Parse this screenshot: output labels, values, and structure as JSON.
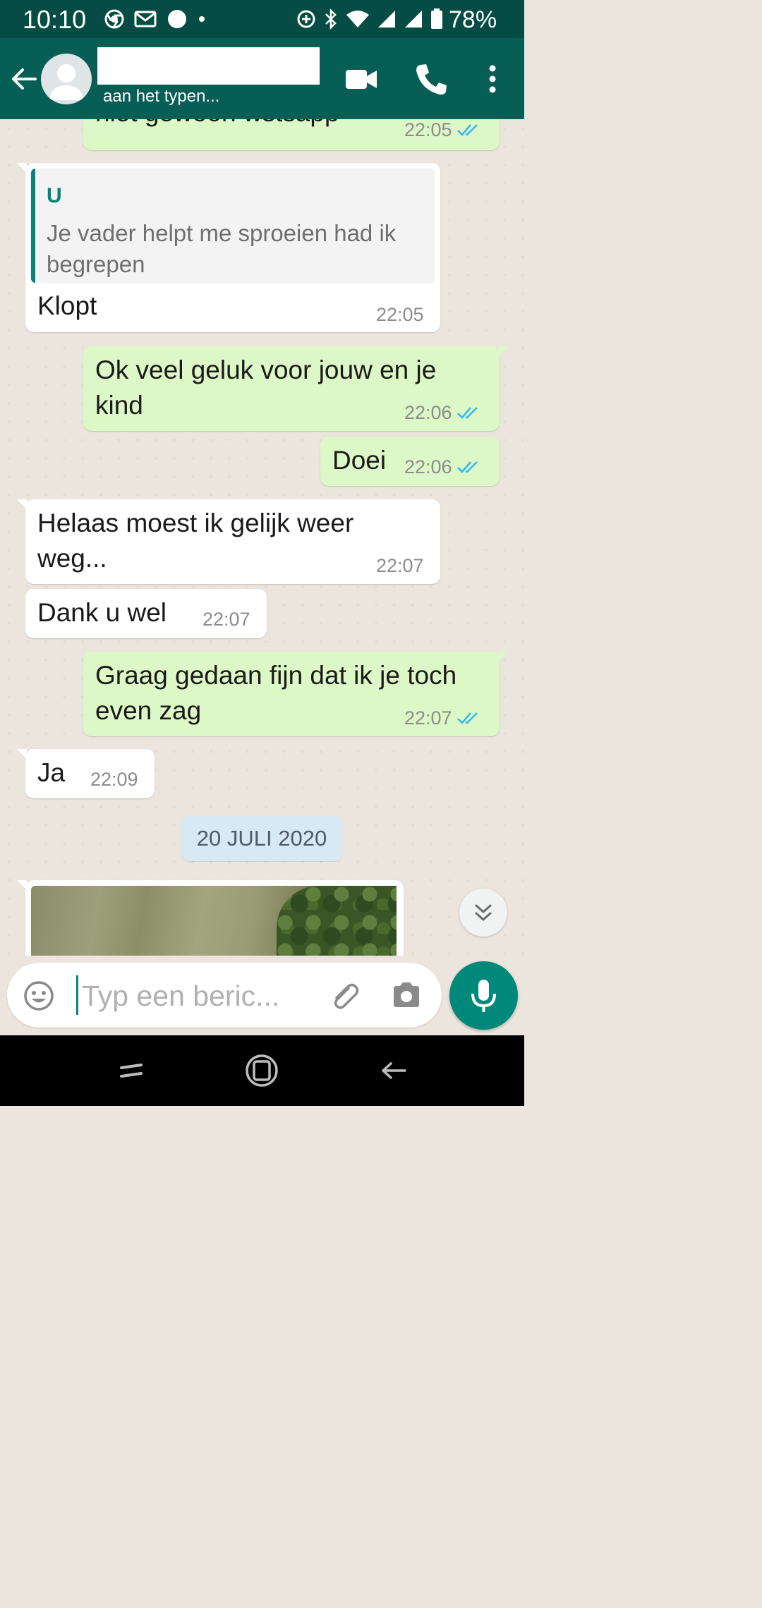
{
  "status_bar": {
    "time": "10:10",
    "battery": "78%",
    "left_icons": [
      "chrome-icon",
      "gmail-icon",
      "circle-notification-icon",
      "dot-icon"
    ],
    "right_icons": [
      "data-saver-icon",
      "bluetooth-icon",
      "wifi-icon",
      "signal-icon",
      "signal-icon-2",
      "battery-icon"
    ]
  },
  "header": {
    "contact_name": "",
    "status": "aan het typen..."
  },
  "messages": [
    {
      "id": "m0",
      "direction": "out",
      "text": "niet gewoon wstsapp",
      "time": "22:05",
      "read": true
    },
    {
      "id": "m1",
      "direction": "in",
      "quote_author": "U",
      "quote_text": "Je vader helpt me sproeien had ik begrepen",
      "text": "Klopt",
      "time": "22:05"
    },
    {
      "id": "m2",
      "direction": "out",
      "text": "Ok veel geluk voor jouw en je kind",
      "time": "22:06",
      "read": true
    },
    {
      "id": "m3",
      "direction": "out",
      "text": "Doei",
      "time": "22:06",
      "read": true
    },
    {
      "id": "m4",
      "direction": "in",
      "text": "Helaas moest ik gelijk weer weg...",
      "time": "22:07"
    },
    {
      "id": "m5",
      "direction": "in",
      "text": "Dank u wel",
      "time": "22:07"
    },
    {
      "id": "m6",
      "direction": "out",
      "text": "Graag gedaan fijn dat ik je toch even zag",
      "time": "22:07",
      "read": true
    },
    {
      "id": "m7",
      "direction": "in",
      "text": "Ja",
      "time": "22:09"
    }
  ],
  "date_divider": "20 JULI 2020",
  "input": {
    "placeholder": "Typ een beric...",
    "value": ""
  },
  "colors": {
    "status_bar": "#054D44",
    "app_bar": "#075E54",
    "chat_bg": "#ECE5DD",
    "outgoing_bubble": "#DCF8C6",
    "incoming_bubble": "#FFFFFF",
    "read_ticks": "#34B7F1",
    "accent": "#00897B",
    "date_chip": "#D7E9F5"
  }
}
